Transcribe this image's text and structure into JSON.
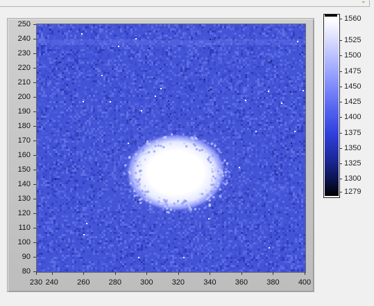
{
  "graph": {
    "title": "",
    "x_ticks": [
      "230",
      "240",
      "260",
      "280",
      "300",
      "320",
      "340",
      "360",
      "380",
      "400"
    ],
    "y_ticks": [
      "250",
      "240",
      "230",
      "220",
      "210",
      "200",
      "190",
      "180",
      "170",
      "160",
      "150",
      "140",
      "130",
      "120",
      "110",
      "100",
      "90",
      "80"
    ],
    "x_range": [
      230,
      400
    ],
    "y_range": [
      80,
      250
    ],
    "background_color": "#4454d6",
    "spot": {
      "center_x": 318,
      "center_y": 148,
      "radius_x": 32,
      "radius_y": 27,
      "color": "#ffffff"
    }
  },
  "colorbar": {
    "labels": [
      "1560",
      "1525",
      "1500",
      "1475",
      "1450",
      "1425",
      "1400",
      "1375",
      "1350",
      "1325",
      "1300",
      "1279"
    ],
    "min": 1279,
    "max": 1560,
    "colors": [
      "#000000",
      "#1a2796",
      "#4454d6",
      "#9aa4ff",
      "#ffffff"
    ]
  }
}
